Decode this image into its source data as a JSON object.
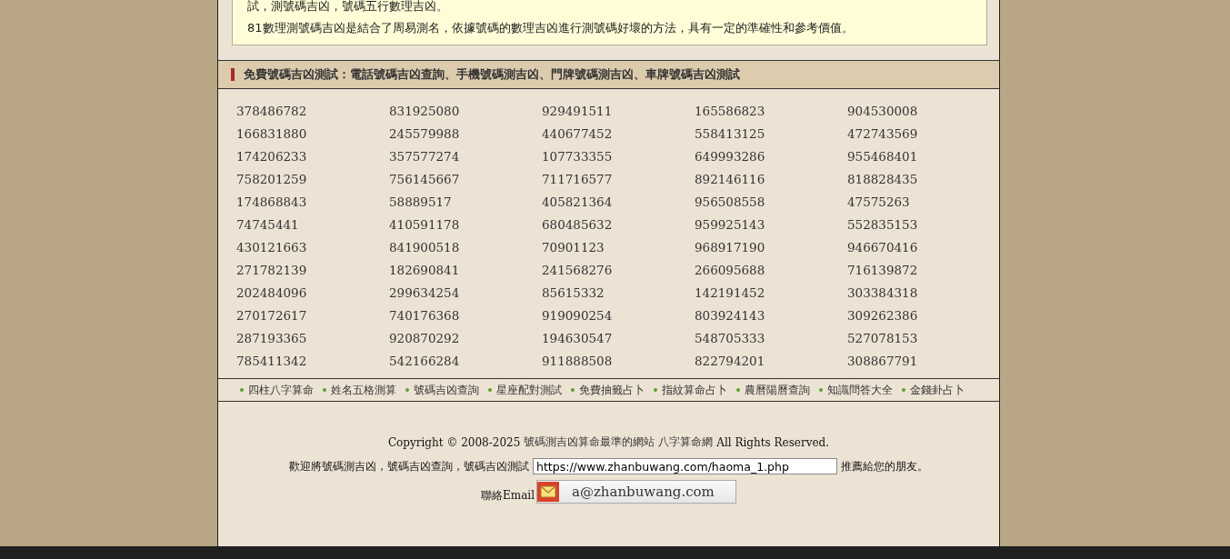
{
  "intro": {
    "lines": [
      "試，測號碼吉凶，號碼五行數理吉凶。",
      "81數理測號碼吉凶是結合了周易測名，依據號碼的數理吉凶進行測號碼好壞的方法，具有一定的準確性和參考價值。"
    ]
  },
  "section_title": "免費號碼吉凶測試：電話號碼吉凶查詢、手機號碼測吉凶、門牌號碼測吉凶、車牌號碼吉凶測試",
  "numbers": [
    "378486782",
    "831925080",
    "929491511",
    "165586823",
    "904530008",
    "166831880",
    "245579988",
    "440677452",
    "558413125",
    "472743569",
    "174206233",
    "357577274",
    "107733355",
    "649993286",
    "955468401",
    "758201259",
    "756145667",
    "711716577",
    "892146116",
    "818828435",
    "174868843",
    "58889517",
    "405821364",
    "956508558",
    "47575263",
    "74745441",
    "410591178",
    "680485632",
    "959925143",
    "552835153",
    "430121663",
    "841900518",
    "70901123",
    "968917190",
    "946670416",
    "271782139",
    "182690841",
    "241568276",
    "266095688",
    "716139872",
    "202484096",
    "299634254",
    "85615332",
    "142191452",
    "303384318",
    "270172617",
    "740176368",
    "919090254",
    "803924143",
    "309262386",
    "287193365",
    "920870292",
    "194630547",
    "548705333",
    "527078153",
    "785411342",
    "542166284",
    "911888508",
    "822794201",
    "308867791"
  ],
  "nav_links": [
    "四柱八字算命",
    "姓名五格測算",
    "號碼吉凶查詢",
    "星座配對測試",
    "免費抽籤占卜",
    "指紋算命占卜",
    "農曆陽曆查詢",
    "知識問答大全",
    "金錢卦占卜"
  ],
  "footer": {
    "copyright_prefix": "Copyright © 2008-2025",
    "site_link": "號碼測吉凶算命最準的網站",
    "brand_link": "八字算命網",
    "copyright_suffix": "All Rights Reserved.",
    "share_prefix": "歡迎將號碼測吉凶，號碼吉凶查詢，號碼吉凶測試",
    "share_url": "https://www.zhanbuwang.com/haoma_1.php",
    "share_suffix": "推薦給您的朋友。",
    "email_label": "聯絡Email",
    "email": "a@zhanbuwang.com"
  }
}
